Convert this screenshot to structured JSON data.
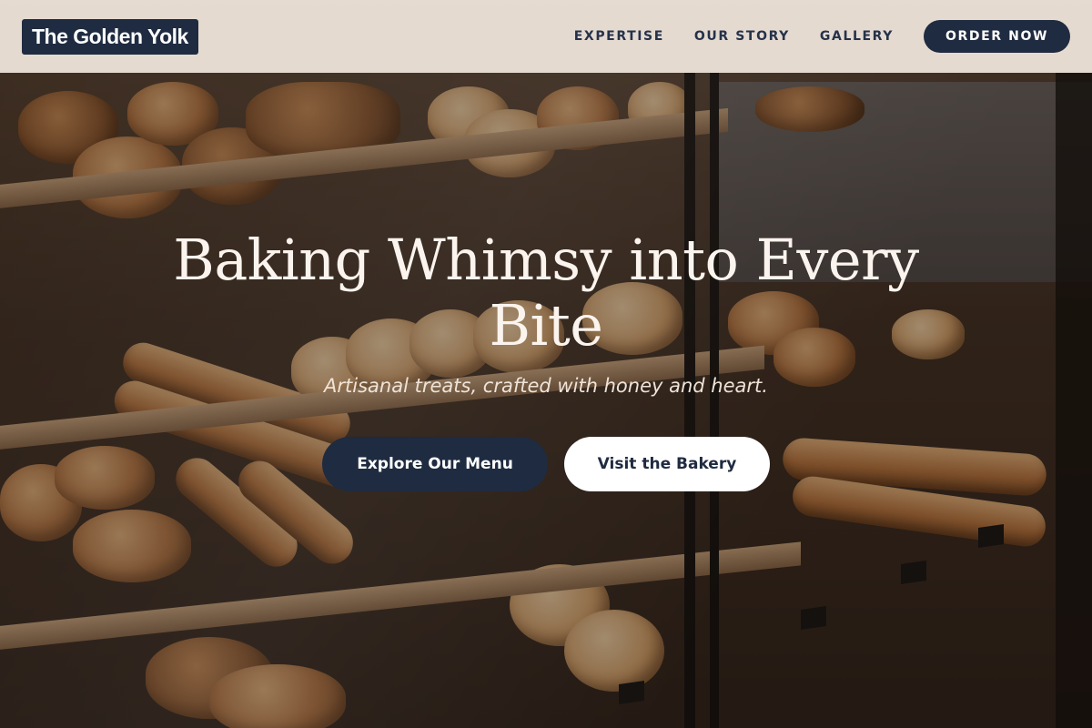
{
  "header": {
    "logo_text": "The Golden Yolk",
    "nav_links": [
      {
        "label": "EXPERTISE"
      },
      {
        "label": "OUR STORY"
      },
      {
        "label": "GALLERY"
      }
    ],
    "order_button_label": "ORDER NOW"
  },
  "hero": {
    "title": "Baking Whimsy into Every Bite",
    "subtitle": "Artisanal treats, crafted with honey and heart.",
    "primary_button_label": "Explore Our Menu",
    "secondary_button_label": "Visit the Bakery",
    "background_image": "bakery display case with breads and pastries"
  },
  "colors": {
    "brand_navy": "#1f2b40",
    "header_bg": "#f3e9df",
    "hero_text": "#fbf4ee"
  }
}
